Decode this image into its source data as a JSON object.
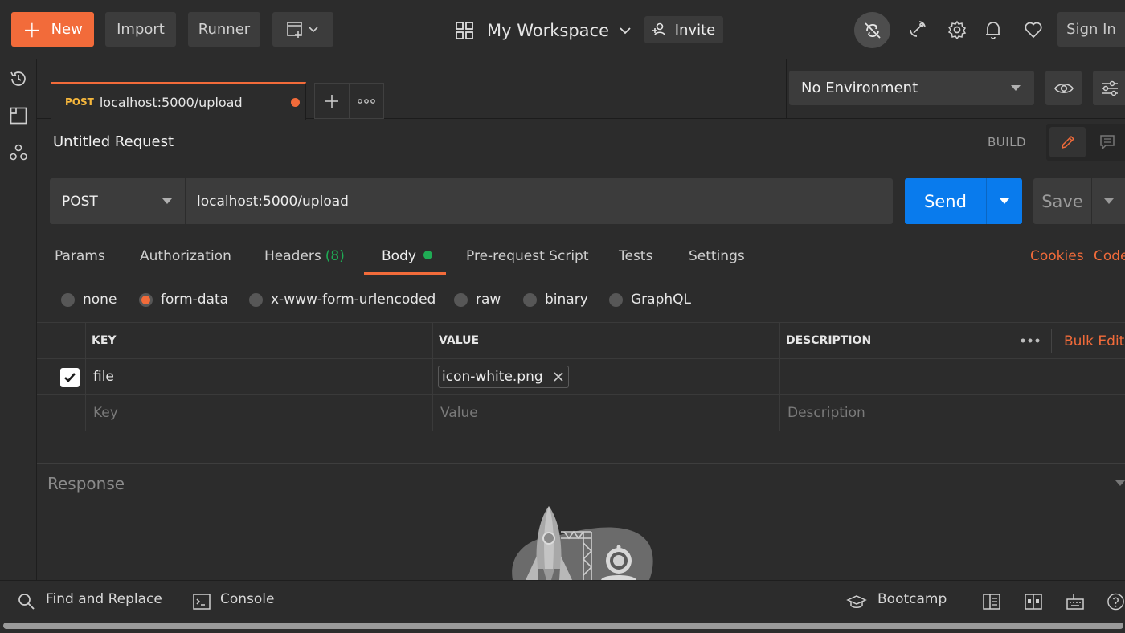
{
  "topbar": {
    "new_label": "New",
    "import_label": "Import",
    "runner_label": "Runner",
    "workspace_label": "My Workspace",
    "invite_label": "Invite",
    "signin_label": "Sign In"
  },
  "tab": {
    "method": "POST",
    "url": "localhost:5000/upload"
  },
  "environment": {
    "selected": "No Environment"
  },
  "request": {
    "name": "Untitled Request",
    "mode_label": "BUILD",
    "method": "POST",
    "url": "localhost:5000/upload",
    "send_label": "Send",
    "save_label": "Save"
  },
  "request_tabs": {
    "params": "Params",
    "authorization": "Authorization",
    "headers": "Headers",
    "headers_count": "(8)",
    "body": "Body",
    "prerequest": "Pre-request Script",
    "tests": "Tests",
    "settings": "Settings",
    "cookies": "Cookies",
    "code": "Code"
  },
  "body_types": {
    "none": "none",
    "form_data": "form-data",
    "urlencoded": "x-www-form-urlencoded",
    "raw": "raw",
    "binary": "binary",
    "graphql": "GraphQL",
    "selected": "form-data"
  },
  "table": {
    "headers": {
      "key": "KEY",
      "value": "VALUE",
      "description": "DESCRIPTION"
    },
    "bulk_edit": "Bulk Edit",
    "rows": [
      {
        "checked": true,
        "key": "file",
        "value": "icon-white.png",
        "description": ""
      }
    ],
    "placeholders": {
      "key": "Key",
      "value": "Value",
      "description": "Description"
    }
  },
  "response": {
    "label": "Response"
  },
  "footer": {
    "find_replace": "Find and Replace",
    "console": "Console",
    "bootcamp": "Bootcamp"
  },
  "colors": {
    "accent": "#f26b3a",
    "send_blue": "#097bed",
    "success_green": "#1fab54",
    "method_post": "#f6b73c"
  },
  "icons": [
    "history-icon",
    "collections-icon",
    "apis-icon",
    "grid-icon",
    "invite-user-icon",
    "sync-off-icon",
    "satellite-icon",
    "gear-icon",
    "bell-icon",
    "heart-icon",
    "eye-icon",
    "sliders-icon",
    "pencil-icon",
    "comment-icon",
    "search-icon",
    "console-icon",
    "graduation-cap-icon",
    "two-pane-icon",
    "layout-icon",
    "keyboard-icon",
    "help-icon"
  ]
}
